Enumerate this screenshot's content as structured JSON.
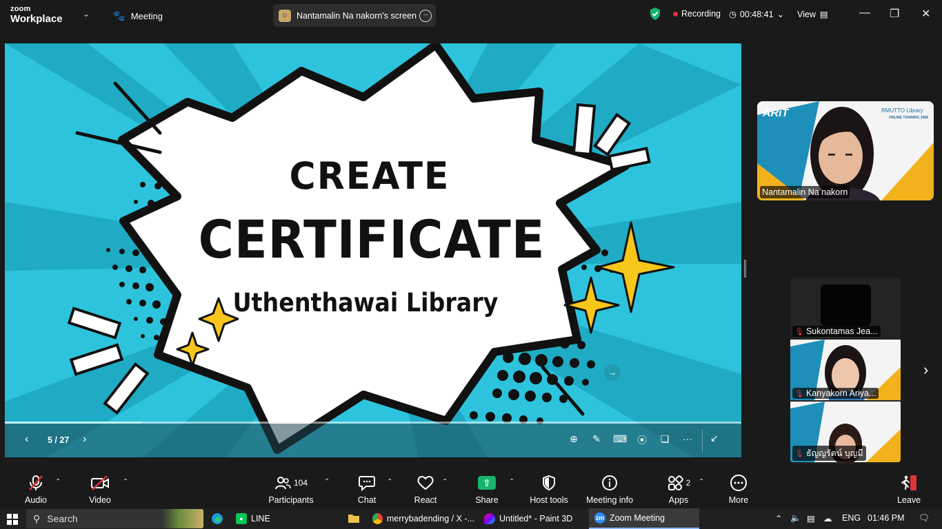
{
  "top_bar": {
    "brand_line1": "zoom",
    "brand_line2": "Workplace",
    "meeting_label": "Meeting",
    "screen_share_label": "Nantamalin Na nakorn's screen",
    "recording_label": "Recording",
    "timer": "00:48:41",
    "view_label": "View"
  },
  "slide": {
    "title_line1": "CREATE",
    "title_line2": "CERTIFICATE",
    "subtitle": "Uthenthawai Library",
    "page_indicator": "5 / 27",
    "progress": 0.185
  },
  "participants": {
    "speaker": {
      "name": "Nantamalin Na nakorn",
      "backdrop_brand": "RMUTTO Library",
      "backdrop_sub": "ONLINE TRAINING 2568",
      "backdrop_logo": "ARiT"
    },
    "gallery": [
      {
        "name": "Sukontamas Jea..."
      },
      {
        "name": "Kanyakorn Ariya..."
      },
      {
        "name": "ธัญญรัตน์ บุญมี"
      }
    ]
  },
  "toolbar": {
    "audio": "Audio",
    "video": "Video",
    "participants": "Participants",
    "participants_count": "104",
    "chat": "Chat",
    "react": "React",
    "share": "Share",
    "host_tools": "Host tools",
    "meeting_info": "Meeting info",
    "apps": "Apps",
    "apps_count": "2",
    "more": "More",
    "leave": "Leave"
  },
  "taskbar": {
    "search_placeholder": "Search",
    "apps": [
      {
        "label": "LINE"
      },
      {
        "label": "merrybadending / X -..."
      },
      {
        "label": "Untitled* - Paint 3D"
      },
      {
        "label": "Zoom Meeting"
      }
    ],
    "language": "ENG",
    "clock": "01:46 PM"
  },
  "colors": {
    "slide_background": "#2ec3dc",
    "accent_star": "#f7c61b",
    "recording_dot": "#e0343b",
    "share_green": "#16b46c",
    "security_green": "#16b46c"
  }
}
